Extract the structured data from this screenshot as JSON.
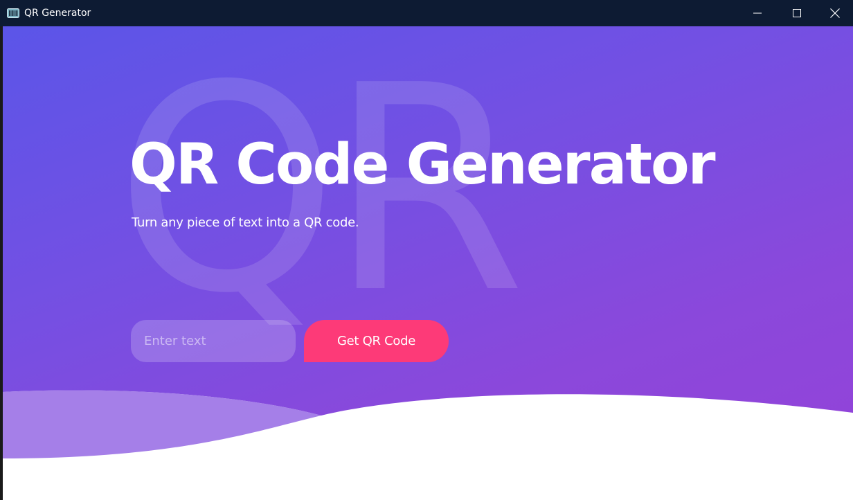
{
  "window": {
    "title": "QR Generator",
    "app_icon": "barcode-app-icon",
    "controls": [
      "minimize-icon",
      "maximize-icon",
      "close-icon"
    ]
  },
  "hero": {
    "watermark": "QR",
    "headline": "QR Code Generator",
    "subtitle": "Turn any piece of text into a QR code."
  },
  "form": {
    "input_value": "",
    "input_placeholder": "Enter text",
    "button_label": "Get QR Code"
  },
  "colors": {
    "titlebar": "#0d1b33",
    "gradient_start": "#5b55e8",
    "gradient_end": "#9442d8",
    "button": "#fd3a78",
    "wave": "#a96ae0",
    "footer": "#ffffff"
  }
}
